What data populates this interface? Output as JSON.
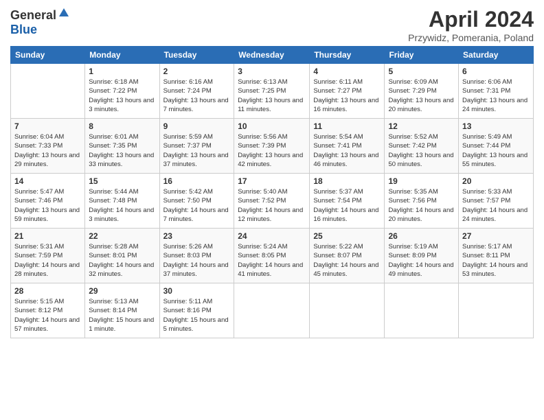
{
  "header": {
    "logo_general": "General",
    "logo_blue": "Blue",
    "month": "April 2024",
    "location": "Przywidz, Pomerania, Poland"
  },
  "calendar": {
    "days_of_week": [
      "Sunday",
      "Monday",
      "Tuesday",
      "Wednesday",
      "Thursday",
      "Friday",
      "Saturday"
    ],
    "weeks": [
      [
        {
          "day": "",
          "sunrise": "",
          "sunset": "",
          "daylight": ""
        },
        {
          "day": "1",
          "sunrise": "Sunrise: 6:18 AM",
          "sunset": "Sunset: 7:22 PM",
          "daylight": "Daylight: 13 hours and 3 minutes."
        },
        {
          "day": "2",
          "sunrise": "Sunrise: 6:16 AM",
          "sunset": "Sunset: 7:24 PM",
          "daylight": "Daylight: 13 hours and 7 minutes."
        },
        {
          "day": "3",
          "sunrise": "Sunrise: 6:13 AM",
          "sunset": "Sunset: 7:25 PM",
          "daylight": "Daylight: 13 hours and 11 minutes."
        },
        {
          "day": "4",
          "sunrise": "Sunrise: 6:11 AM",
          "sunset": "Sunset: 7:27 PM",
          "daylight": "Daylight: 13 hours and 16 minutes."
        },
        {
          "day": "5",
          "sunrise": "Sunrise: 6:09 AM",
          "sunset": "Sunset: 7:29 PM",
          "daylight": "Daylight: 13 hours and 20 minutes."
        },
        {
          "day": "6",
          "sunrise": "Sunrise: 6:06 AM",
          "sunset": "Sunset: 7:31 PM",
          "daylight": "Daylight: 13 hours and 24 minutes."
        }
      ],
      [
        {
          "day": "7",
          "sunrise": "Sunrise: 6:04 AM",
          "sunset": "Sunset: 7:33 PM",
          "daylight": "Daylight: 13 hours and 29 minutes."
        },
        {
          "day": "8",
          "sunrise": "Sunrise: 6:01 AM",
          "sunset": "Sunset: 7:35 PM",
          "daylight": "Daylight: 13 hours and 33 minutes."
        },
        {
          "day": "9",
          "sunrise": "Sunrise: 5:59 AM",
          "sunset": "Sunset: 7:37 PM",
          "daylight": "Daylight: 13 hours and 37 minutes."
        },
        {
          "day": "10",
          "sunrise": "Sunrise: 5:56 AM",
          "sunset": "Sunset: 7:39 PM",
          "daylight": "Daylight: 13 hours and 42 minutes."
        },
        {
          "day": "11",
          "sunrise": "Sunrise: 5:54 AM",
          "sunset": "Sunset: 7:41 PM",
          "daylight": "Daylight: 13 hours and 46 minutes."
        },
        {
          "day": "12",
          "sunrise": "Sunrise: 5:52 AM",
          "sunset": "Sunset: 7:42 PM",
          "daylight": "Daylight: 13 hours and 50 minutes."
        },
        {
          "day": "13",
          "sunrise": "Sunrise: 5:49 AM",
          "sunset": "Sunset: 7:44 PM",
          "daylight": "Daylight: 13 hours and 55 minutes."
        }
      ],
      [
        {
          "day": "14",
          "sunrise": "Sunrise: 5:47 AM",
          "sunset": "Sunset: 7:46 PM",
          "daylight": "Daylight: 13 hours and 59 minutes."
        },
        {
          "day": "15",
          "sunrise": "Sunrise: 5:44 AM",
          "sunset": "Sunset: 7:48 PM",
          "daylight": "Daylight: 14 hours and 3 minutes."
        },
        {
          "day": "16",
          "sunrise": "Sunrise: 5:42 AM",
          "sunset": "Sunset: 7:50 PM",
          "daylight": "Daylight: 14 hours and 7 minutes."
        },
        {
          "day": "17",
          "sunrise": "Sunrise: 5:40 AM",
          "sunset": "Sunset: 7:52 PM",
          "daylight": "Daylight: 14 hours and 12 minutes."
        },
        {
          "day": "18",
          "sunrise": "Sunrise: 5:37 AM",
          "sunset": "Sunset: 7:54 PM",
          "daylight": "Daylight: 14 hours and 16 minutes."
        },
        {
          "day": "19",
          "sunrise": "Sunrise: 5:35 AM",
          "sunset": "Sunset: 7:56 PM",
          "daylight": "Daylight: 14 hours and 20 minutes."
        },
        {
          "day": "20",
          "sunrise": "Sunrise: 5:33 AM",
          "sunset": "Sunset: 7:57 PM",
          "daylight": "Daylight: 14 hours and 24 minutes."
        }
      ],
      [
        {
          "day": "21",
          "sunrise": "Sunrise: 5:31 AM",
          "sunset": "Sunset: 7:59 PM",
          "daylight": "Daylight: 14 hours and 28 minutes."
        },
        {
          "day": "22",
          "sunrise": "Sunrise: 5:28 AM",
          "sunset": "Sunset: 8:01 PM",
          "daylight": "Daylight: 14 hours and 32 minutes."
        },
        {
          "day": "23",
          "sunrise": "Sunrise: 5:26 AM",
          "sunset": "Sunset: 8:03 PM",
          "daylight": "Daylight: 14 hours and 37 minutes."
        },
        {
          "day": "24",
          "sunrise": "Sunrise: 5:24 AM",
          "sunset": "Sunset: 8:05 PM",
          "daylight": "Daylight: 14 hours and 41 minutes."
        },
        {
          "day": "25",
          "sunrise": "Sunrise: 5:22 AM",
          "sunset": "Sunset: 8:07 PM",
          "daylight": "Daylight: 14 hours and 45 minutes."
        },
        {
          "day": "26",
          "sunrise": "Sunrise: 5:19 AM",
          "sunset": "Sunset: 8:09 PM",
          "daylight": "Daylight: 14 hours and 49 minutes."
        },
        {
          "day": "27",
          "sunrise": "Sunrise: 5:17 AM",
          "sunset": "Sunset: 8:11 PM",
          "daylight": "Daylight: 14 hours and 53 minutes."
        }
      ],
      [
        {
          "day": "28",
          "sunrise": "Sunrise: 5:15 AM",
          "sunset": "Sunset: 8:12 PM",
          "daylight": "Daylight: 14 hours and 57 minutes."
        },
        {
          "day": "29",
          "sunrise": "Sunrise: 5:13 AM",
          "sunset": "Sunset: 8:14 PM",
          "daylight": "Daylight: 15 hours and 1 minute."
        },
        {
          "day": "30",
          "sunrise": "Sunrise: 5:11 AM",
          "sunset": "Sunset: 8:16 PM",
          "daylight": "Daylight: 15 hours and 5 minutes."
        },
        {
          "day": "",
          "sunrise": "",
          "sunset": "",
          "daylight": ""
        },
        {
          "day": "",
          "sunrise": "",
          "sunset": "",
          "daylight": ""
        },
        {
          "day": "",
          "sunrise": "",
          "sunset": "",
          "daylight": ""
        },
        {
          "day": "",
          "sunrise": "",
          "sunset": "",
          "daylight": ""
        }
      ]
    ]
  }
}
